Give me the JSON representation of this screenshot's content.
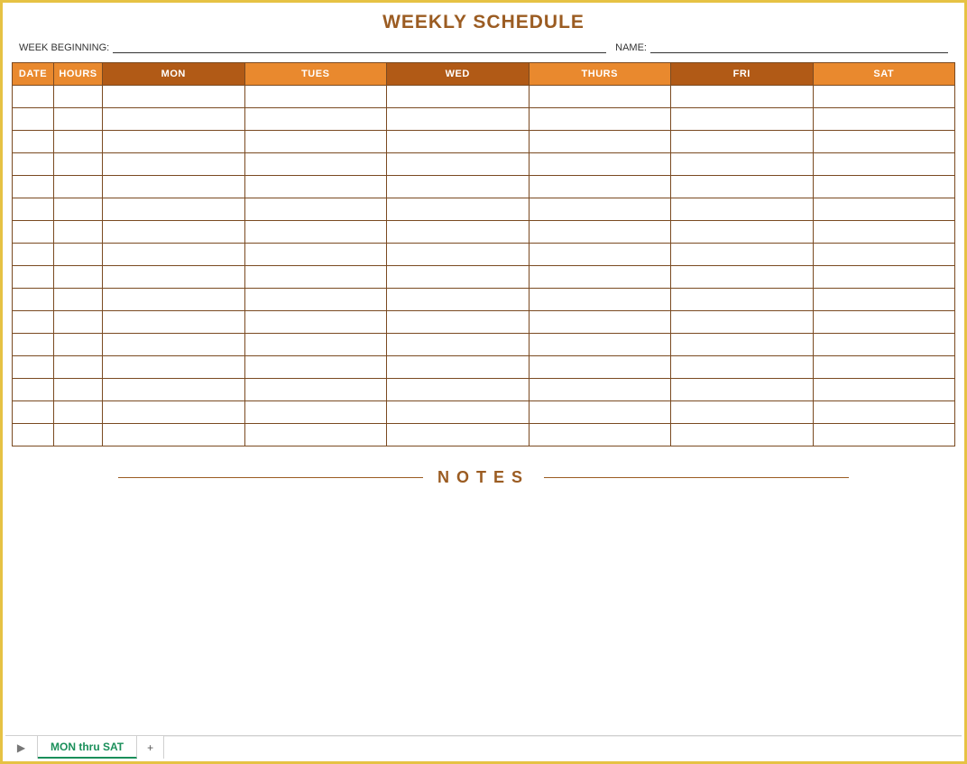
{
  "title": "WEEKLY SCHEDULE",
  "meta": {
    "week_beginning_label": "WEEK BEGINNING:",
    "week_beginning_value": "",
    "name_label": "NAME:",
    "name_value": ""
  },
  "table": {
    "headers": {
      "date": "DATE",
      "hours": "HOURS",
      "days": [
        "MON",
        "TUES",
        "WED",
        "THURS",
        "FRI",
        "SAT"
      ]
    },
    "row_count": 16
  },
  "notes": {
    "label": "NOTES"
  },
  "sheetbar": {
    "active_tab": "MON thru SAT",
    "nav_glyph": "▶",
    "add_glyph": "+"
  }
}
